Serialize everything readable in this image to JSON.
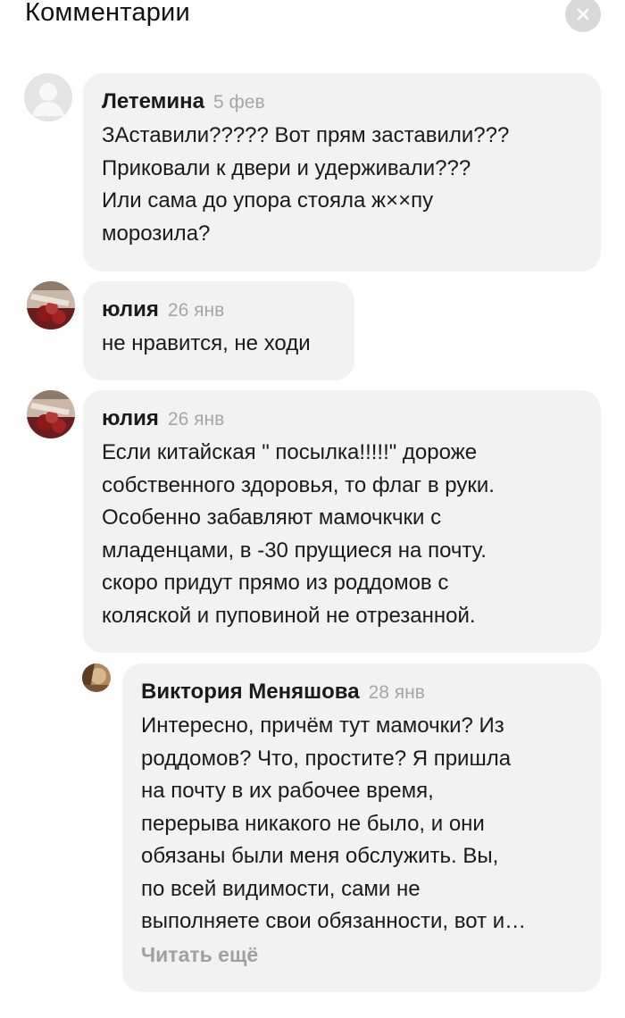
{
  "header": {
    "title": "Комментарии",
    "close_icon": "close-icon"
  },
  "comments": [
    {
      "author": "Летемина",
      "date": "5 фев",
      "avatar": "default-avatar-icon",
      "text": "ЗАставили????? Вот прям заставили???\nПриковали  к двери и удерживали???\nИли сама до упора стояла ж××пу\nморозила?"
    },
    {
      "author": "юлия",
      "date": "26 янв",
      "avatar": "user-photo",
      "text": "не нравится, не ходи"
    },
    {
      "author": "юлия",
      "date": "26 янв",
      "avatar": "user-photo",
      "text": "Если китайская \" посылка!!!!!\" дороже\nсобственного здоровья, то флаг в руки.\nОсобенно забавляют мамочкчки с\nмладенцами, в -30 прущиеся на почту.\nскоро придут прямо из роддомов с\nколяской и пуповиной не отрезанной."
    },
    {
      "author": "Виктория Меняшова",
      "date": "28 янв",
      "avatar": "user-photo",
      "text": "Интересно, причём тут мамочки? Из\nроддомов? Что, простите? Я пришла\nна почту в их рабочее время,\nперерыва никакого не было, и они\nобязаны были меня обслужить. Вы,\nпо всей видимости, сами не\nвыполняете свои обязанности, вот и…",
      "read_more": "Читать ещё"
    }
  ],
  "colors": {
    "bubble": "#f2f2f2",
    "date": "#a6a6a6",
    "close_bg": "#d9d9d9"
  }
}
